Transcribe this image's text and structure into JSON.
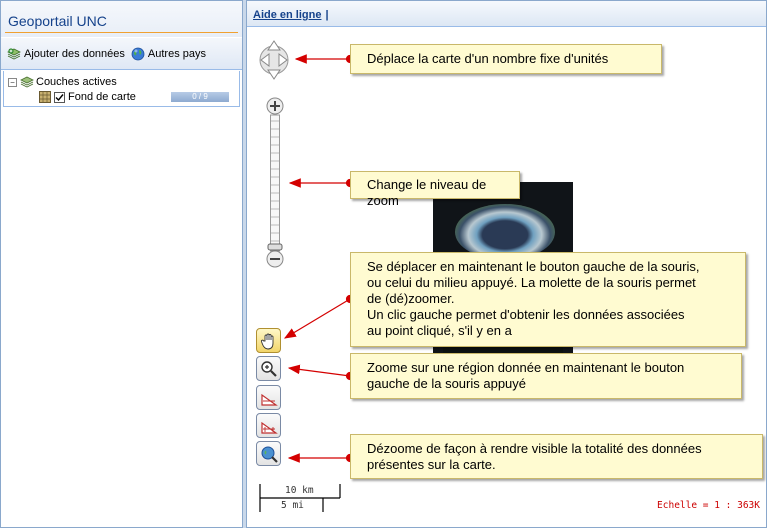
{
  "left_panel": {
    "title": "Geoportail UNC",
    "toolbar": {
      "add_data_label": "Ajouter des données",
      "other_countries_label": "Autres pays"
    },
    "tree": {
      "group_label": "Couches actives",
      "layer_label": "Fond de carte",
      "opacity_label": "0 / 9"
    }
  },
  "right_panel": {
    "help_link": "Aide en ligne",
    "separator": "|"
  },
  "callouts": {
    "pan": "Déplace la carte d'un nombre fixe d'unités",
    "zoom_level": "Change le niveau de zoom",
    "drag_line1": "Se déplacer en maintenant le bouton gauche de la souris,",
    "drag_line2": "ou celui  du milieu appuyé. La molette de la souris permet",
    "drag_line3": "de (dé)zoomer.",
    "drag_line4": "Un clic gauche permet d'obtenir les données associées",
    "drag_line5": "au point cliqué, s'il y en a",
    "zoom_box_line1": "Zoome sur une région donnée en maintenant le bouton",
    "zoom_box_line2": "gauche de la souris appuyé",
    "zoom_extent_line1": "Dézoome de façon à rendre visible la totalité des données",
    "zoom_extent_line2": "présentes sur la carte."
  },
  "scale": {
    "km_label": "10 km",
    "mi_label": "5 mi",
    "ratio_text": "Echelle = 1 : 363K"
  },
  "colors": {
    "arrow_red": "#d40000",
    "callout_bg": "#fffbd1",
    "panel_border": "#8aa8cc"
  }
}
